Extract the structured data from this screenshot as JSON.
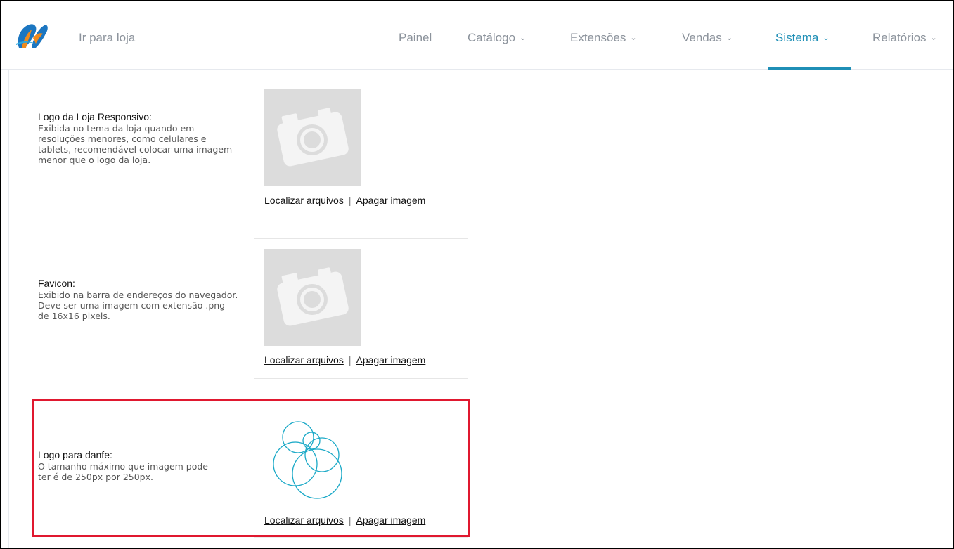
{
  "header": {
    "store_link": "Ir para loja",
    "nav": [
      {
        "label": "Painel",
        "has_dropdown": false,
        "active": false
      },
      {
        "label": "Catálogo",
        "has_dropdown": true,
        "active": false
      },
      {
        "label": "Extensões",
        "has_dropdown": true,
        "active": false
      },
      {
        "label": "Vendas",
        "has_dropdown": true,
        "active": false
      },
      {
        "label": "Sistema",
        "has_dropdown": true,
        "active": true
      },
      {
        "label": "Relatórios",
        "has_dropdown": true,
        "active": false
      }
    ],
    "chevron": "⌄"
  },
  "colors": {
    "accent": "#1f8fb6",
    "nav_text": "#8c939c",
    "highlight": "#e0182f",
    "placeholder": "#dcdcdc"
  },
  "settings": [
    {
      "title": "Logo da Loja Responsivo:",
      "help": "Exibida no tema da loja quando em resoluções menores, como celulares e tablets, recomendável colocar uma imagem menor que o logo da loja.",
      "image": "camera-placeholder-icon",
      "find_label": "Localizar arquivos",
      "separator": "|",
      "delete_label": "Apagar imagem"
    },
    {
      "title": "Favicon:",
      "help": "Exibido na barra de endereços do navegador. Deve ser uma imagem com extensão .png de 16x16 pixels.",
      "image": "camera-placeholder-icon",
      "find_label": "Localizar arquivos",
      "separator": "|",
      "delete_label": "Apagar imagem"
    },
    {
      "title": "Logo para danfe:",
      "help": "O tamanho máximo que imagem pode ter é de 250px por 250px.",
      "image": "circles-logo-image",
      "find_label": "Localizar arquivos",
      "separator": "|",
      "delete_label": "Apagar imagem",
      "highlighted": true
    }
  ]
}
